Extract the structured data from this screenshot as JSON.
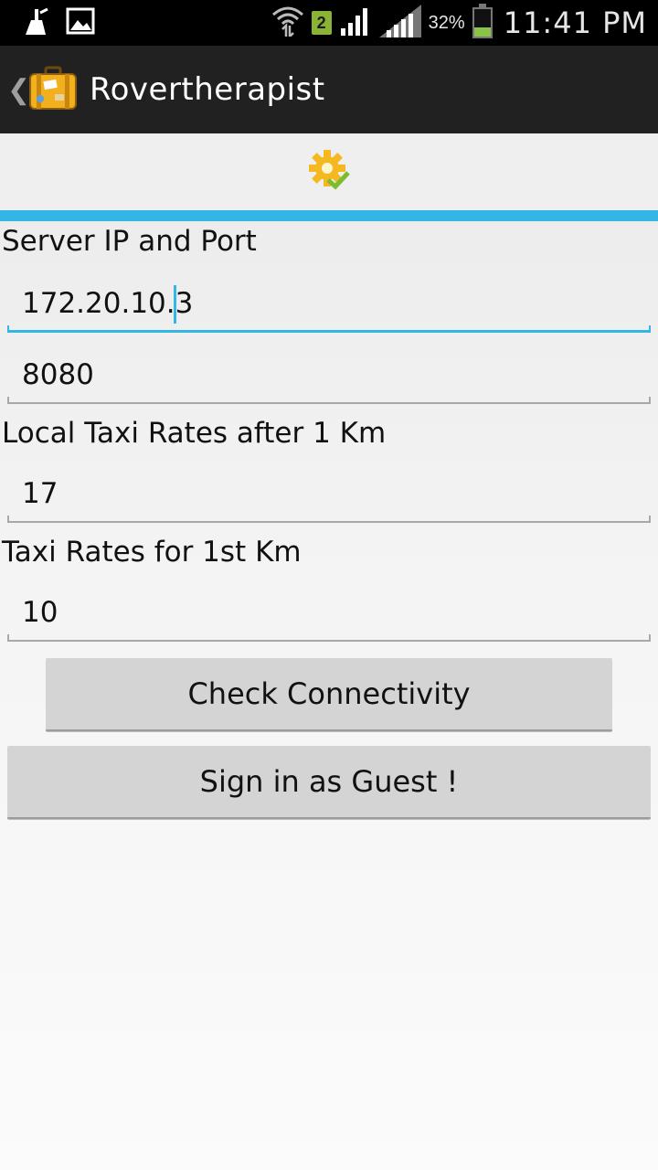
{
  "status_bar": {
    "sim_slot": "2",
    "battery_percent": "32%",
    "time": "11:41 PM",
    "icons": [
      "cleaner-icon",
      "image-icon",
      "wifi-icon",
      "signal-icon",
      "signal-icon-2",
      "battery-icon"
    ]
  },
  "action_bar": {
    "title": "Rovertherapist",
    "icon": "suitcase-icon"
  },
  "tabs": {
    "active_icon": "settings-gear-icon",
    "indicator_color": "#33b5e5"
  },
  "form": {
    "server_label": "Server IP and Port",
    "server_ip": "172.20.10.3",
    "server_port": "8080",
    "local_rate_label": "Local Taxi Rates after 1 Km",
    "local_rate_value": "17",
    "first_km_label": "Taxi Rates for 1st Km",
    "first_km_value": "10"
  },
  "buttons": {
    "check_connectivity": "Check Connectivity",
    "sign_in_guest": "Sign in as Guest !"
  }
}
